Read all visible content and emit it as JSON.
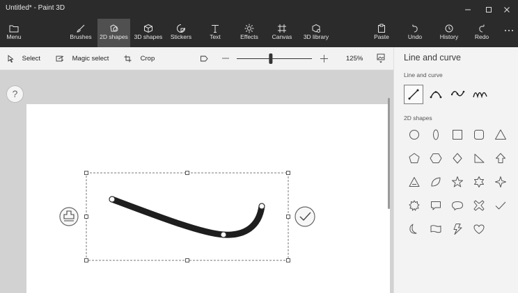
{
  "window": {
    "title": "Untitled* - Paint 3D"
  },
  "ribbon": {
    "items": [
      {
        "label": "Menu",
        "icon": "folder-icon"
      },
      {
        "label": "Brushes",
        "icon": "brush-icon"
      },
      {
        "label": "2D shapes",
        "icon": "2d-shapes-icon",
        "active": true
      },
      {
        "label": "3D shapes",
        "icon": "cube-icon"
      },
      {
        "label": "Stickers",
        "icon": "sticker-icon"
      },
      {
        "label": "Text",
        "icon": "text-icon"
      },
      {
        "label": "Effects",
        "icon": "sun-icon"
      },
      {
        "label": "Canvas",
        "icon": "canvas-icon"
      },
      {
        "label": "3D library",
        "icon": "3d-library-icon"
      },
      {
        "label": "Paste",
        "icon": "paste-icon"
      },
      {
        "label": "Undo",
        "icon": "undo-icon"
      },
      {
        "label": "History",
        "icon": "history-icon"
      },
      {
        "label": "Redo",
        "icon": "redo-icon"
      }
    ]
  },
  "toolbar": {
    "select_label": "Select",
    "magic_select_label": "Magic select",
    "crop_label": "Crop",
    "zoom_value": "125%",
    "zoom_level": 0.45
  },
  "workspace": {
    "help_label": "?"
  },
  "panel": {
    "title": "Line and curve",
    "line_section": "Line and curve",
    "shapes_section": "2D shapes",
    "line_tools": [
      "line-icon",
      "curve-3pt-icon",
      "curve-4pt-icon",
      "curve-5pt-icon"
    ],
    "shapes": [
      "circle-icon",
      "ellipse-icon",
      "square-icon",
      "rounded-square-icon",
      "triangle-icon",
      "pentagon-icon",
      "hexagon-icon",
      "diamond-icon",
      "right-triangle-icon",
      "arrow-up-icon",
      "triangle-outline-icon",
      "leaf-icon",
      "star5-icon",
      "star6-icon",
      "star4-icon",
      "burst-icon",
      "callout-rect-icon",
      "callout-oval-icon",
      "cross-icon",
      "check-icon",
      "moon-icon",
      "banner-icon",
      "lightning-icon",
      "heart-icon"
    ]
  },
  "colors": {
    "titlebar": "#2b2b2b",
    "active_tab": "#505050",
    "stroke": "#1e1e1e"
  }
}
